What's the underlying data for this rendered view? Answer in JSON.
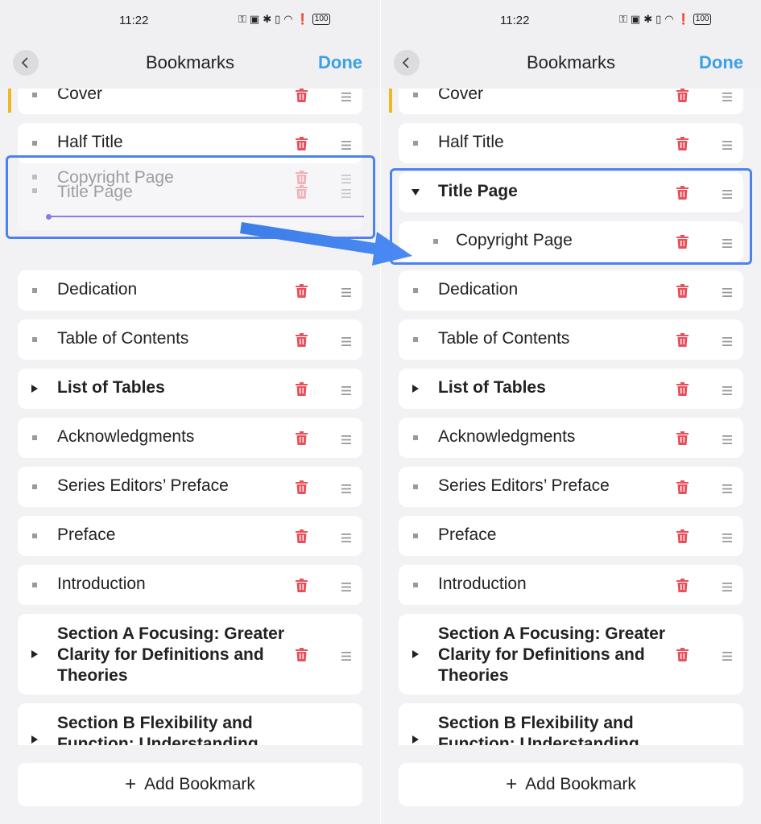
{
  "status": {
    "time": "11:22",
    "battery": "100"
  },
  "nav": {
    "title": "Bookmarks",
    "done": "Done"
  },
  "left_panel": {
    "items": [
      {
        "label": "Cover"
      },
      {
        "label": "Half Title"
      },
      {
        "label": "Dedication"
      },
      {
        "label": "Table of Contents"
      },
      {
        "label": "List of Tables",
        "expandable": true
      },
      {
        "label": "Acknowledgments"
      },
      {
        "label": "Series Editors’ Preface"
      },
      {
        "label": "Preface"
      },
      {
        "label": "Introduction"
      },
      {
        "label": "Section A Focusing: Greater Clarity for Definitions and Theories",
        "expandable": true
      },
      {
        "label": "Section B Flexibility and Function: Understanding",
        "expandable": true
      }
    ],
    "drag_ghost": {
      "dragged_label": "Copyright Page",
      "target_label": "Title Page"
    }
  },
  "right_panel": {
    "items": [
      {
        "label": "Cover"
      },
      {
        "label": "Half Title"
      },
      {
        "label": "Title Page",
        "expandable": true,
        "expanded": true
      },
      {
        "label": "Copyright Page",
        "child": true
      },
      {
        "label": "Dedication"
      },
      {
        "label": "Table of Contents"
      },
      {
        "label": "List of Tables",
        "expandable": true
      },
      {
        "label": "Acknowledgments"
      },
      {
        "label": "Series Editors’ Preface"
      },
      {
        "label": "Preface"
      },
      {
        "label": "Introduction"
      },
      {
        "label": "Section A Focusing: Greater Clarity for Definitions and Theories",
        "expandable": true
      },
      {
        "label": "Section B Flexibility and Function: Understanding",
        "expandable": true
      }
    ]
  },
  "add_bookmark": {
    "label": "Add Bookmark"
  },
  "colors": {
    "accent_blue": "#3aa0e8",
    "highlight": "#4c82f0",
    "trash_red": "#e8505b",
    "insert_line": "#8a7be6",
    "accent_yellow": "#f0b820"
  },
  "icons": [
    "back-arrow-icon",
    "trash-icon",
    "drag-handle-icon",
    "plus-icon",
    "bullet-icon",
    "expand-triangle-icon"
  ]
}
